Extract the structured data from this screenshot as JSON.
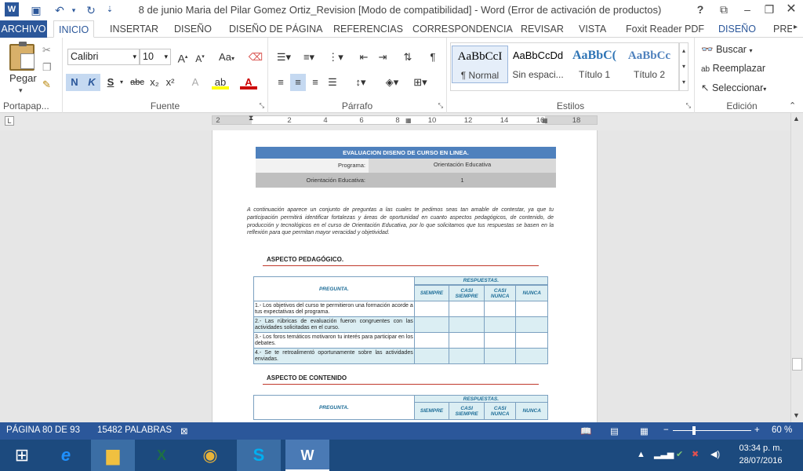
{
  "window": {
    "title": "8 de junio Maria del Pilar Gomez Ortiz_Revision [Modo de compatibilidad] - Word (Error de activación de productos)",
    "help": "?",
    "app_icon": "W"
  },
  "tabs": [
    "ARCHIVO",
    "INICIO",
    "INSERTAR",
    "DISEÑO",
    "DISEÑO DE PÁGINA",
    "REFERENCIAS",
    "CORRESPONDENCIA",
    "REVISAR",
    "VISTA",
    "Foxit Reader PDF",
    "DISEÑO",
    "PRES"
  ],
  "ribbon": {
    "clipboard": {
      "paste": "Pegar",
      "label": "Portapap..."
    },
    "font": {
      "name": "Calibri",
      "size": "10",
      "label": "Fuente",
      "bold": "N",
      "italic": "K",
      "underline": "S",
      "strike": "abc",
      "sub": "x₂",
      "sup": "x²",
      "case": "Aa"
    },
    "paragraph": {
      "label": "Párrafo"
    },
    "styles": {
      "label": "Estilos",
      "items": [
        {
          "preview": "AaBbCcI",
          "name": "¶ Normal"
        },
        {
          "preview": "AaBbCcDd",
          "name": "Sin espaci..."
        },
        {
          "preview": "AaBbC(",
          "name": "Título 1"
        },
        {
          "preview": "AaBbCc",
          "name": "Título 2"
        }
      ]
    },
    "editing": {
      "label": "Edición",
      "find": "Buscar",
      "replace": "Reemplazar",
      "select": "Seleccionar"
    }
  },
  "ruler": {
    "ticks": [
      "2",
      "2",
      "4",
      "6",
      "8",
      "10",
      "12",
      "14",
      "16",
      "18"
    ]
  },
  "doc": {
    "header_title": "EVALUACION  DISENO DE CURSO EN LINEA.",
    "programa_label": "Programa:",
    "programa_value": "Orientación Educativa",
    "oe_label": "Orientación Educativa:",
    "oe_value": "1",
    "intro": " A continuación aparece un conjunto de  preguntas a las cuales te pedimos seas tan amable de contestar, ya que tu participación permitirá  identificar fortalezas y áreas de oportunidad en cuanto aspectos pedagógicos, de contenido, de producción y tecnológicos en el curso de Orientación Educativa, por lo que solicitamos que tus respuestas se basen en la reflexión para que permitan mayor veracidad y objetividad.",
    "section1": "ASPECTO PEDAGÓGICO.",
    "section2": "ASPECTO DE CONTENIDO",
    "table": {
      "pregunta": "PREGUNTA.",
      "respuestas": "RESPUESTAS.",
      "cols": [
        "SIEMPRE",
        "CASI SIEMPRE",
        "CASI NUNCA",
        "NUNCA"
      ],
      "rows": [
        "1.- Los objetivos del curso te permitieron una formación acorde a tus expectativas del programa.",
        "2.- Las rúbricas de evaluación fueron congruentes con las actividades solicitadas en el curso.",
        "3.- Los foros temáticos motivaron tu interés para participar en los debates.",
        "4.- Se te retroalimentó oportunamente sobre las actividades enviadas."
      ]
    }
  },
  "status": {
    "page": "PÁGINA 80 DE 93",
    "words": "15482 PALABRAS",
    "zoom": "60 %"
  },
  "taskbar": {
    "time": "03:34 p. m.",
    "date": "28/07/2016"
  },
  "colors": {
    "accent": "#2b579a",
    "header_blue": "#4f81bd",
    "taskbar": "#1c4a7e"
  }
}
